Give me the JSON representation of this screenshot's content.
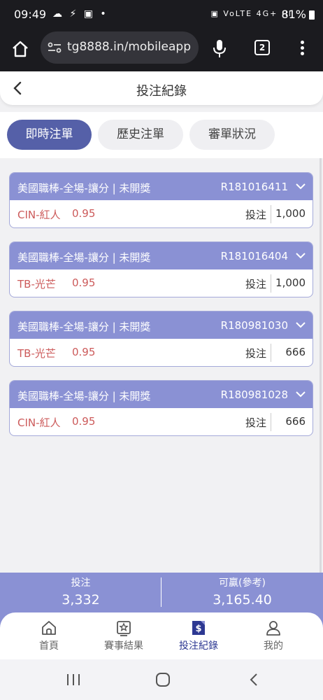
{
  "status_bar": {
    "time": "09:49",
    "left_icons": "☁ ⚡ ▣ •",
    "right_icons": "▣ VoLTE 4G+ ıll",
    "battery": "81%"
  },
  "browser": {
    "url": "tg8888.in/mobileapp",
    "tab_count": "2"
  },
  "header": {
    "title": "投注紀錄"
  },
  "tabs": [
    {
      "label": "即時注單",
      "active": true
    },
    {
      "label": "歷史注單",
      "active": false
    },
    {
      "label": "審單狀況",
      "active": false
    }
  ],
  "bets": [
    {
      "league": "美國職棒-全場-讓分 | 未開獎",
      "order_no": "R181016411",
      "pick": "CIN-紅人",
      "odds": "0.95",
      "stake_label": "投注",
      "stake": "1,000"
    },
    {
      "league": "美國職棒-全場-讓分 | 未開獎",
      "order_no": "R181016404",
      "pick": "TB-光芒",
      "odds": "0.95",
      "stake_label": "投注",
      "stake": "1,000"
    },
    {
      "league": "美國職棒-全場-讓分 | 未開獎",
      "order_no": "R180981030",
      "pick": "TB-光芒",
      "odds": "0.95",
      "stake_label": "投注",
      "stake": "666"
    },
    {
      "league": "美國職棒-全場-讓分 | 未開獎",
      "order_no": "R180981028",
      "pick": "CIN-紅人",
      "odds": "0.95",
      "stake_label": "投注",
      "stake": "666"
    }
  ],
  "summary": {
    "stake_label": "投注",
    "stake_total": "3,332",
    "win_label": "可贏(參考)",
    "win_total": "3,165.40"
  },
  "nav": [
    {
      "label": "首頁",
      "icon": "home-icon"
    },
    {
      "label": "賽事結果",
      "icon": "trophy-icon"
    },
    {
      "label": "投注紀錄",
      "icon": "dollar-doc-icon"
    },
    {
      "label": "我的",
      "icon": "user-icon"
    }
  ],
  "colors": {
    "accent": "#5560a8",
    "card_header": "#8a91d4",
    "pick_text": "#cc5a5a",
    "nav_active": "#2d3892"
  }
}
